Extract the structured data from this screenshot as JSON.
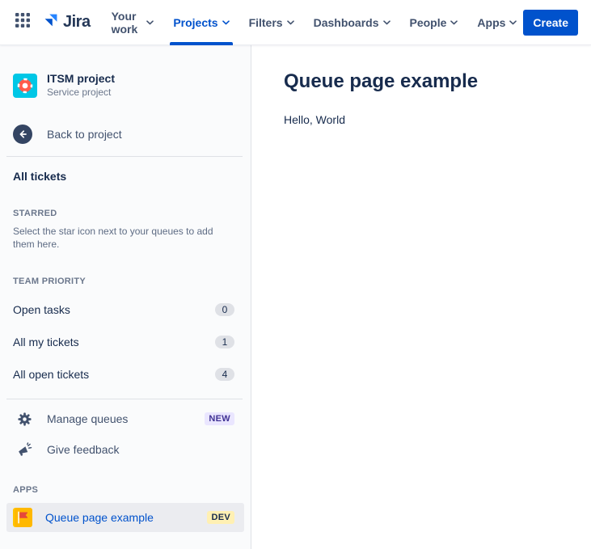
{
  "nav": {
    "logo_text": "Jira",
    "items": [
      {
        "label": "Your work",
        "active": false
      },
      {
        "label": "Projects",
        "active": true
      },
      {
        "label": "Filters",
        "active": false
      },
      {
        "label": "Dashboards",
        "active": false
      },
      {
        "label": "People",
        "active": false
      },
      {
        "label": "Apps",
        "active": false
      }
    ],
    "create_label": "Create"
  },
  "sidebar": {
    "project": {
      "name": "ITSM project",
      "type": "Service project"
    },
    "back_label": "Back to project",
    "all_tickets_label": "All tickets",
    "starred": {
      "header": "STARRED",
      "description": "Select the star icon next to your queues to add them here."
    },
    "team_priority": {
      "header": "TEAM PRIORITY",
      "items": [
        {
          "label": "Open tasks",
          "count": "0"
        },
        {
          "label": "All my tickets",
          "count": "1"
        },
        {
          "label": "All open tickets",
          "count": "4"
        }
      ]
    },
    "tools": {
      "manage_label": "Manage queues",
      "manage_badge": "NEW",
      "feedback_label": "Give feedback"
    },
    "apps": {
      "header": "APPS",
      "items": [
        {
          "label": "Queue page example",
          "badge": "DEV"
        }
      ]
    }
  },
  "main": {
    "title": "Queue page example",
    "body": "Hello, World"
  },
  "colors": {
    "accent_blue": "#0052CC",
    "text_dark": "#172B4D",
    "sidebar_bg": "#FAFBFC",
    "highlight_row": "#EBECF0",
    "new_badge_bg": "#EAE6FF",
    "new_badge_text": "#403294",
    "dev_badge_bg": "#FFF0B3",
    "count_badge_bg": "#DFE1E6",
    "project_avatar_bg": "#00C7E6",
    "app_icon_bg": "#FFC400"
  }
}
